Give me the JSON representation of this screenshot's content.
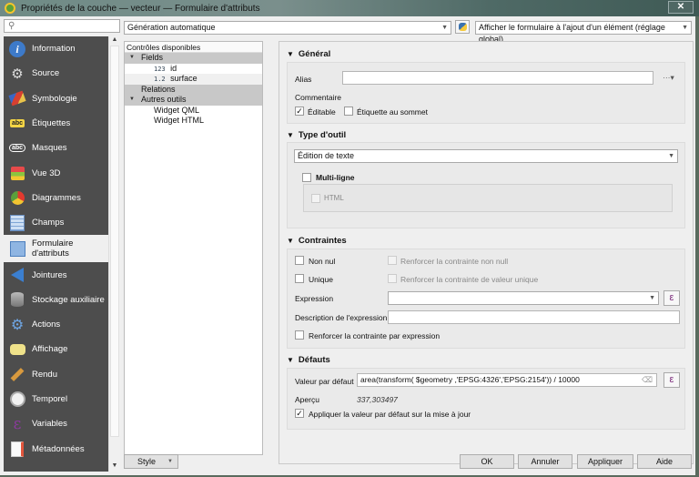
{
  "window": {
    "title": "Propriétés de la couche — vecteur — Formulaire d'attributs",
    "close_label": "✕"
  },
  "search": {
    "placeholder": "",
    "icon": "search-icon"
  },
  "sidebar": {
    "items": [
      {
        "label": "Information",
        "icon": "info-icon"
      },
      {
        "label": "Source",
        "icon": "source-icon"
      },
      {
        "label": "Symbologie",
        "icon": "symbology-icon"
      },
      {
        "label": "Étiquettes",
        "icon": "labels-icon"
      },
      {
        "label": "Masques",
        "icon": "masks-icon"
      },
      {
        "label": "Vue 3D",
        "icon": "3d-view-icon"
      },
      {
        "label": "Diagrammes",
        "icon": "diagrams-icon"
      },
      {
        "label": "Champs",
        "icon": "fields-icon"
      },
      {
        "label": "Formulaire d'attributs",
        "icon": "attribute-form-icon",
        "selected": true
      },
      {
        "label": "Jointures",
        "icon": "joins-icon"
      },
      {
        "label": "Stockage auxiliaire",
        "icon": "auxiliary-storage-icon"
      },
      {
        "label": "Actions",
        "icon": "actions-icon"
      },
      {
        "label": "Affichage",
        "icon": "display-icon"
      },
      {
        "label": "Rendu",
        "icon": "rendering-icon"
      },
      {
        "label": "Temporel",
        "icon": "temporal-icon"
      },
      {
        "label": "Variables",
        "icon": "variables-icon"
      },
      {
        "label": "Métadonnées",
        "icon": "metadata-icon"
      }
    ]
  },
  "toolbar": {
    "layout_combo": "Génération automatique",
    "suppress_combo": "Afficher le formulaire à l'ajout d'un élément (réglage global)"
  },
  "tree": {
    "header": "Contrôles disponibles",
    "fields_group": "Fields",
    "fields": [
      {
        "type": "123",
        "name": "id"
      },
      {
        "type": "1.2",
        "name": "surface"
      }
    ],
    "relations_group": "Relations",
    "other_group": "Autres outils",
    "other_tools": [
      "Widget QML",
      "Widget HTML"
    ]
  },
  "general": {
    "title": "Général",
    "alias_label": "Alias",
    "alias_value": "",
    "comment_label": "Commentaire",
    "editable_label": "Éditable",
    "editable_checked": true,
    "label_on_top_label": "Étiquette au sommet",
    "label_on_top_checked": false
  },
  "widget_type": {
    "title": "Type d'outil",
    "selected": "Édition de texte",
    "multiline_label": "Multi-ligne",
    "multiline_checked": false,
    "html_label": "HTML",
    "html_checked": false
  },
  "constraints": {
    "title": "Contraintes",
    "not_null_label": "Non nul",
    "enforce_not_null_label": "Renforcer la contrainte non null",
    "unique_label": "Unique",
    "enforce_unique_label": "Renforcer la contrainte de valeur unique",
    "expression_label": "Expression",
    "expression_value": "",
    "expression_desc_label": "Description de l'expression",
    "expression_desc_value": "",
    "enforce_expression_label": "Renforcer la contrainte par expression"
  },
  "defaults": {
    "title": "Défauts",
    "default_value_label": "Valeur par défaut",
    "default_value": "area(transform( $geometry ,'EPSG:4326','EPSG:2154')) / 10000",
    "preview_label": "Aperçu",
    "preview_value": "337,303497",
    "apply_on_update_label": "Appliquer la valeur par défaut sur la mise à jour",
    "apply_on_update_checked": true
  },
  "buttons": {
    "style": "Style",
    "ok": "OK",
    "cancel": "Annuler",
    "apply": "Appliquer",
    "help": "Aide"
  },
  "glyphs": {
    "caret_down": "▼",
    "check": "✓",
    "epsilon": "ε",
    "clear": "⌫",
    "search": "⚲",
    "more": "···▾"
  }
}
